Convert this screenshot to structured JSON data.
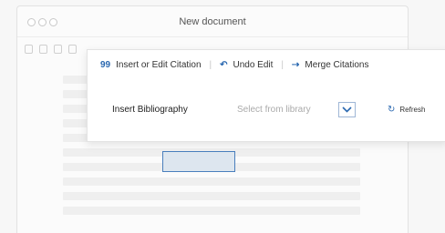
{
  "window": {
    "title": "New document"
  },
  "plugin_panel": {
    "insert_edit_icon": "99",
    "insert_edit_label": "Insert or Edit Citation",
    "undo_icon": "undo-arrow",
    "undo_label": "Undo Edit",
    "merge_icon": "merge-arrow",
    "merge_label": "Merge Citations",
    "insert_bibliography_label": "Insert Bibliography",
    "library_select_placeholder": "Select from library",
    "refresh_label": "Refresh"
  },
  "colors": {
    "accent": "#2a68b0",
    "selection_border": "#4a7fbd"
  }
}
